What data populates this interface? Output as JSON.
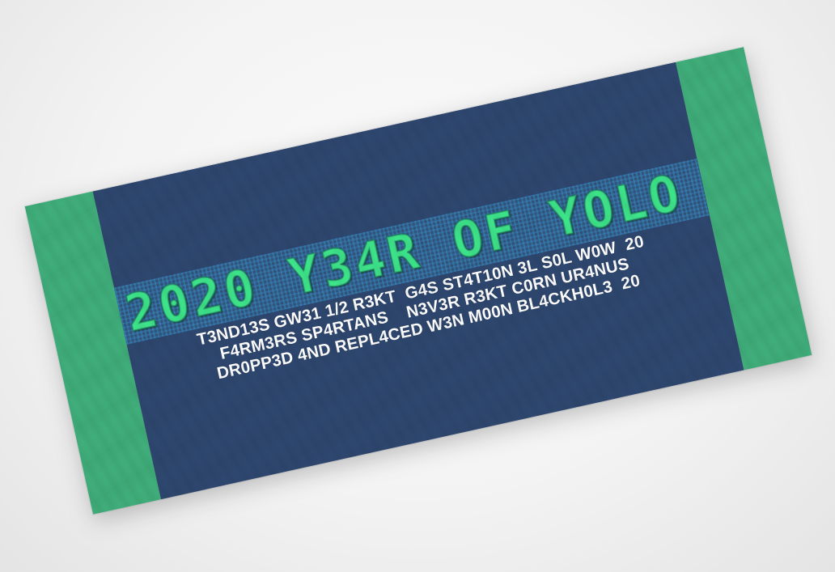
{
  "colors": {
    "towel_body": "#2e476f",
    "towel_ends": "#3fae7a",
    "headline": "#3de48a",
    "text": "#ffffff",
    "background": "#f3f3f3"
  },
  "towel": {
    "headline": "2020 Y34R OF YOLO",
    "lines": [
      "T3ND13S GW31 1/2 R3KT  G4S ST4T10N 3L S0L W0W  20",
      "F4RM3RS SP4RTANS    N3V3R R3KT C0RN UR4NUS",
      "DR0PP3D 4ND REPL4CED W3N M00N BL4CKH0L3  20"
    ]
  }
}
